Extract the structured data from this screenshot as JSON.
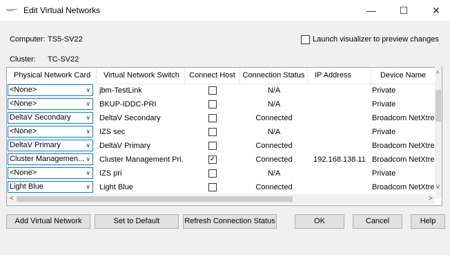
{
  "window": {
    "title": "Edit Virtual Networks",
    "min_glyph": "—",
    "max_glyph": "☐",
    "close_glyph": "✕"
  },
  "computer": {
    "label": "Computer:",
    "value": "TS5-SV22"
  },
  "cluster": {
    "label": "Cluster:",
    "value": "TC-SV22"
  },
  "launch_visualizer": {
    "label": "Launch visualizer to preview changes",
    "checked": false
  },
  "table": {
    "columns": [
      "Physical Network Card",
      "Virtual Network Switch",
      "Connect Host",
      "Connection Status",
      "IP Address",
      "Device Name"
    ],
    "rows": [
      {
        "nic": "<None>",
        "switch": "jbm-TestLink",
        "connect_host": false,
        "status": "N/A",
        "ip": "",
        "device": "Private"
      },
      {
        "nic": "<None>",
        "switch": "BKUP-IDDC-PRI",
        "connect_host": false,
        "status": "N/A",
        "ip": "",
        "device": "Private"
      },
      {
        "nic": "DeltaV Secondary",
        "switch": "DeltaV Secondary",
        "connect_host": false,
        "status": "Connected",
        "ip": "",
        "device": "Broadcom NetXtreme."
      },
      {
        "nic": "<None>",
        "switch": "IZS sec",
        "connect_host": false,
        "status": "N/A",
        "ip": "",
        "device": "Private"
      },
      {
        "nic": "DeltaV Primary",
        "switch": "DeltaV Primary",
        "connect_host": false,
        "status": "Connected",
        "ip": "",
        "device": "Broadcom NetXtreme."
      },
      {
        "nic": "Cluster Managemen...",
        "switch": "Cluster Management Pri...",
        "connect_host": true,
        "status": "Connected",
        "ip": "192.168.138.11",
        "device": "Broadcom NetXtreme."
      },
      {
        "nic": "<None>",
        "switch": "IZS pri",
        "connect_host": false,
        "status": "N/A",
        "ip": "",
        "device": "Private"
      },
      {
        "nic": "Light Blue",
        "switch": "Light Blue",
        "connect_host": false,
        "status": "Connected",
        "ip": "",
        "device": "Broadcom NetXtreme."
      }
    ]
  },
  "scroll": {
    "up": "^",
    "down": "v",
    "left": "<",
    "right": ">"
  },
  "buttons": {
    "add_virtual_network": "Add Virtual Network",
    "set_to_default": "Set to Default",
    "refresh": "Refresh Connection Status",
    "ok": "OK",
    "cancel": "Cancel",
    "help": "Help"
  },
  "colors": {
    "accent": "#0078d7",
    "check": "#333333"
  }
}
